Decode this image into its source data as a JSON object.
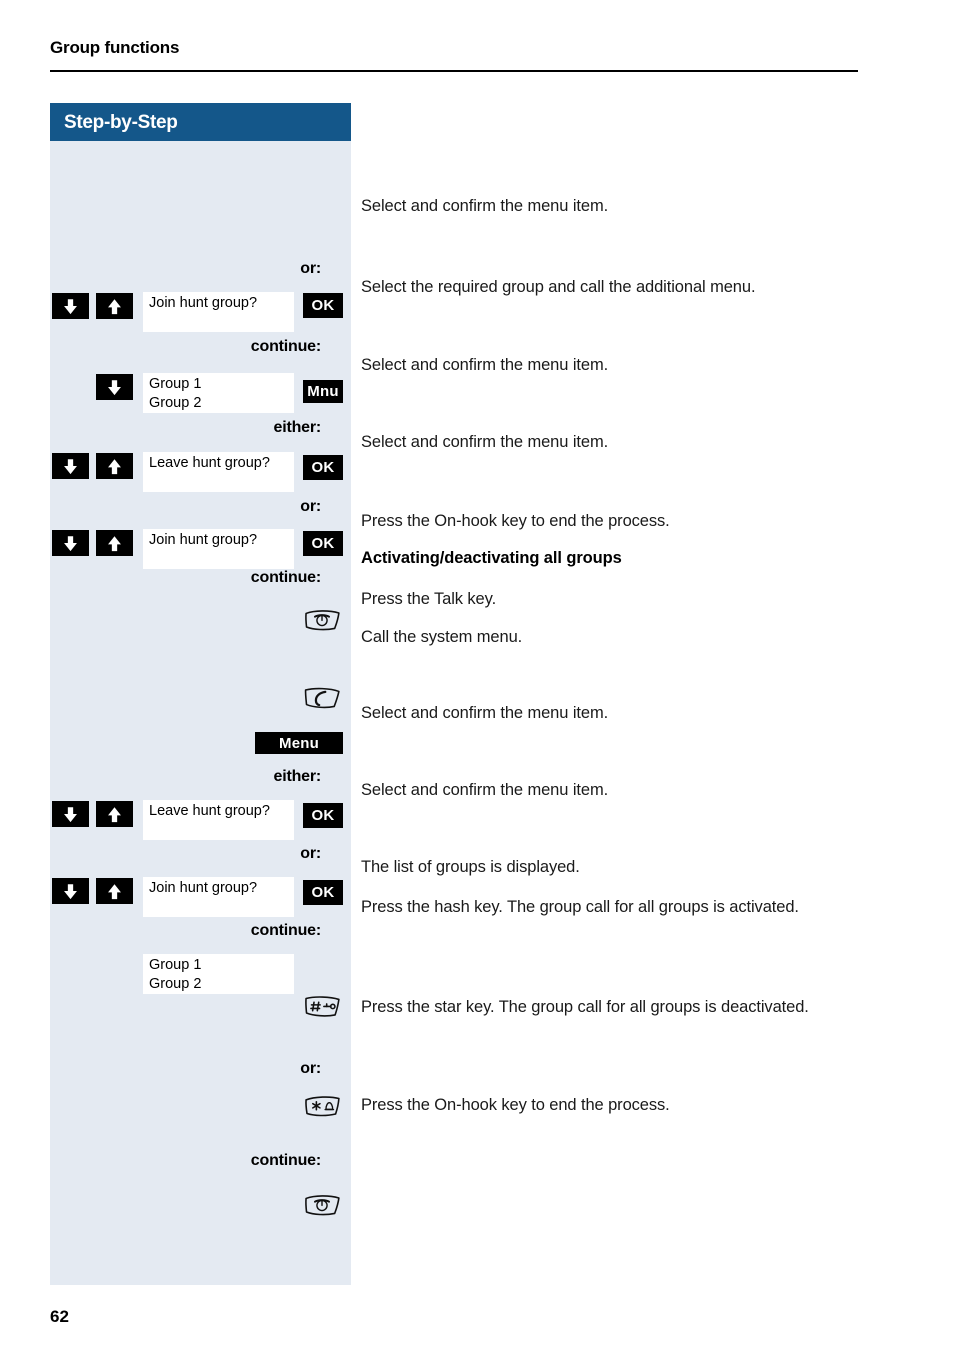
{
  "document": {
    "header_title": "Group functions",
    "page_number": "62"
  },
  "panel": {
    "title": "Step-by-Step",
    "accent_color": "#14578a",
    "background_color": "#e4eaf2"
  },
  "connectors": {
    "or_1": "or:",
    "continue_1": "continue:",
    "either_1": "either:",
    "or_2": "or:",
    "continue_2": "continue:",
    "either_2": "either:",
    "or_3": "or:",
    "continue_3": "continue:",
    "or_4": "or:",
    "continue_4": "continue:"
  },
  "steps": [
    {
      "id": "join-hunt-group-1",
      "keys": [
        "down-arrow-key",
        "up-arrow-key"
      ],
      "display_lines": [
        "Join hunt group?"
      ],
      "softkey": "OK",
      "explanation": "Select and confirm the menu item."
    },
    {
      "id": "select-group-mnu",
      "keys": [
        "down-arrow-key"
      ],
      "display_lines": [
        "Group 1",
        "Group 2"
      ],
      "softkey": "Mnu",
      "explanation": "Select the required group and call the additional menu."
    },
    {
      "id": "leave-hunt-group-1",
      "keys": [
        "down-arrow-key",
        "up-arrow-key"
      ],
      "display_lines": [
        "Leave hunt group?"
      ],
      "softkey": "OK",
      "explanation": "Select and confirm the menu item."
    },
    {
      "id": "join-hunt-group-2",
      "keys": [
        "down-arrow-key",
        "up-arrow-key"
      ],
      "display_lines": [
        "Join hunt group?"
      ],
      "softkey": "OK",
      "explanation": "Select and confirm the menu item."
    },
    {
      "id": "on-hook-end-1",
      "keys": [
        "on-hook-key"
      ],
      "display_lines": [],
      "softkey": "",
      "explanation": "Press the On-hook key to end the process."
    },
    {
      "id": "section-heading",
      "keys": [],
      "display_lines": [],
      "softkey": "",
      "explanation": "Activating/deactivating all groups"
    },
    {
      "id": "talk-key",
      "keys": [
        "talk-key"
      ],
      "display_lines": [],
      "softkey": "",
      "explanation": "Press the Talk key."
    },
    {
      "id": "system-menu",
      "keys": [],
      "display_lines": [],
      "softkey": "Menu",
      "explanation": "Call the system menu."
    },
    {
      "id": "leave-hunt-group-2",
      "keys": [
        "down-arrow-key",
        "up-arrow-key"
      ],
      "display_lines": [
        "Leave hunt group?"
      ],
      "softkey": "OK",
      "explanation": "Select and confirm the menu item."
    },
    {
      "id": "join-hunt-group-3",
      "keys": [
        "down-arrow-key",
        "up-arrow-key"
      ],
      "display_lines": [
        "Join hunt group?"
      ],
      "softkey": "OK",
      "explanation": "Select and confirm the menu item."
    },
    {
      "id": "group-list-displayed",
      "keys": [],
      "display_lines": [
        "Group 1",
        "Group 2"
      ],
      "softkey": "",
      "explanation": "The list of groups is displayed."
    },
    {
      "id": "hash-key-activate",
      "keys": [
        "hash-key"
      ],
      "display_lines": [],
      "softkey": "",
      "explanation": "Press the hash key. The group call for all groups is activated."
    },
    {
      "id": "star-key-deactivate",
      "keys": [
        "star-key"
      ],
      "display_lines": [],
      "softkey": "",
      "explanation": "Press the star key. The group call for all groups is deactivated."
    },
    {
      "id": "on-hook-end-2",
      "keys": [
        "on-hook-key"
      ],
      "display_lines": [],
      "softkey": "",
      "explanation": "Press the On-hook key to end the process."
    }
  ],
  "display_values": {
    "join_hunt_group": "Join hunt group?",
    "leave_hunt_group": "Leave hunt group?",
    "group_1": "Group 1",
    "group_2": "Group 2"
  },
  "softkeys": {
    "ok": "OK",
    "mnu": "Mnu",
    "menu": "Menu"
  },
  "explanations": {
    "select_confirm": "Select and confirm the menu item.",
    "select_group_menu": "Select the required group and call the additional menu.",
    "on_hook_end": "Press the On-hook key to end the process.",
    "section_heading": "Activating/deactivating all groups",
    "talk_key": "Press the Talk key.",
    "system_menu": "Call the system menu.",
    "group_list_displayed": "The list of groups is displayed.",
    "hash_key": "Press the hash key. The group call for all groups is activated.",
    "star_key": "Press the star key. The group call for all groups is deactivated."
  }
}
